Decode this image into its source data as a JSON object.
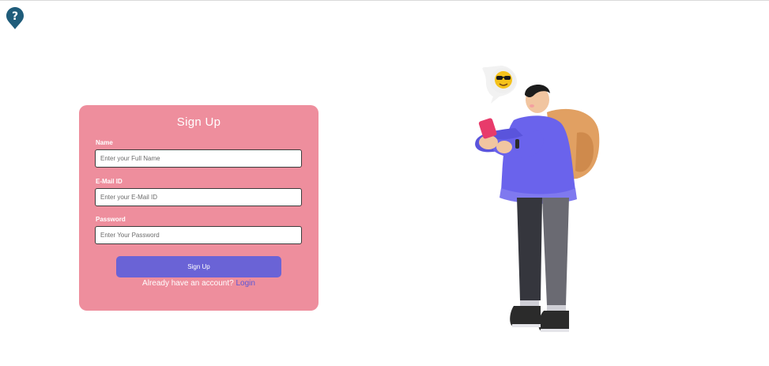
{
  "form": {
    "title": "Sign Up",
    "name_label": "Name",
    "name_placeholder": "Enter your Full Name",
    "email_label": "E-Mail ID",
    "email_placeholder": "Enter your E-Mail ID",
    "password_label": "Password",
    "password_placeholder": "Enter Your Password",
    "submit_label": "Sign Up",
    "account_prompt": "Already have an account?",
    "login_link": "Login"
  },
  "icons": {
    "help": "question-marker-icon",
    "illustration": "person-with-phone-illustration",
    "emoji": "sunglasses-emoji-icon"
  },
  "colors": {
    "card_bg": "#ee8e9d",
    "button_bg": "#6a63d6",
    "link": "#5b57d6",
    "help_icon": "#1f5c7a"
  }
}
